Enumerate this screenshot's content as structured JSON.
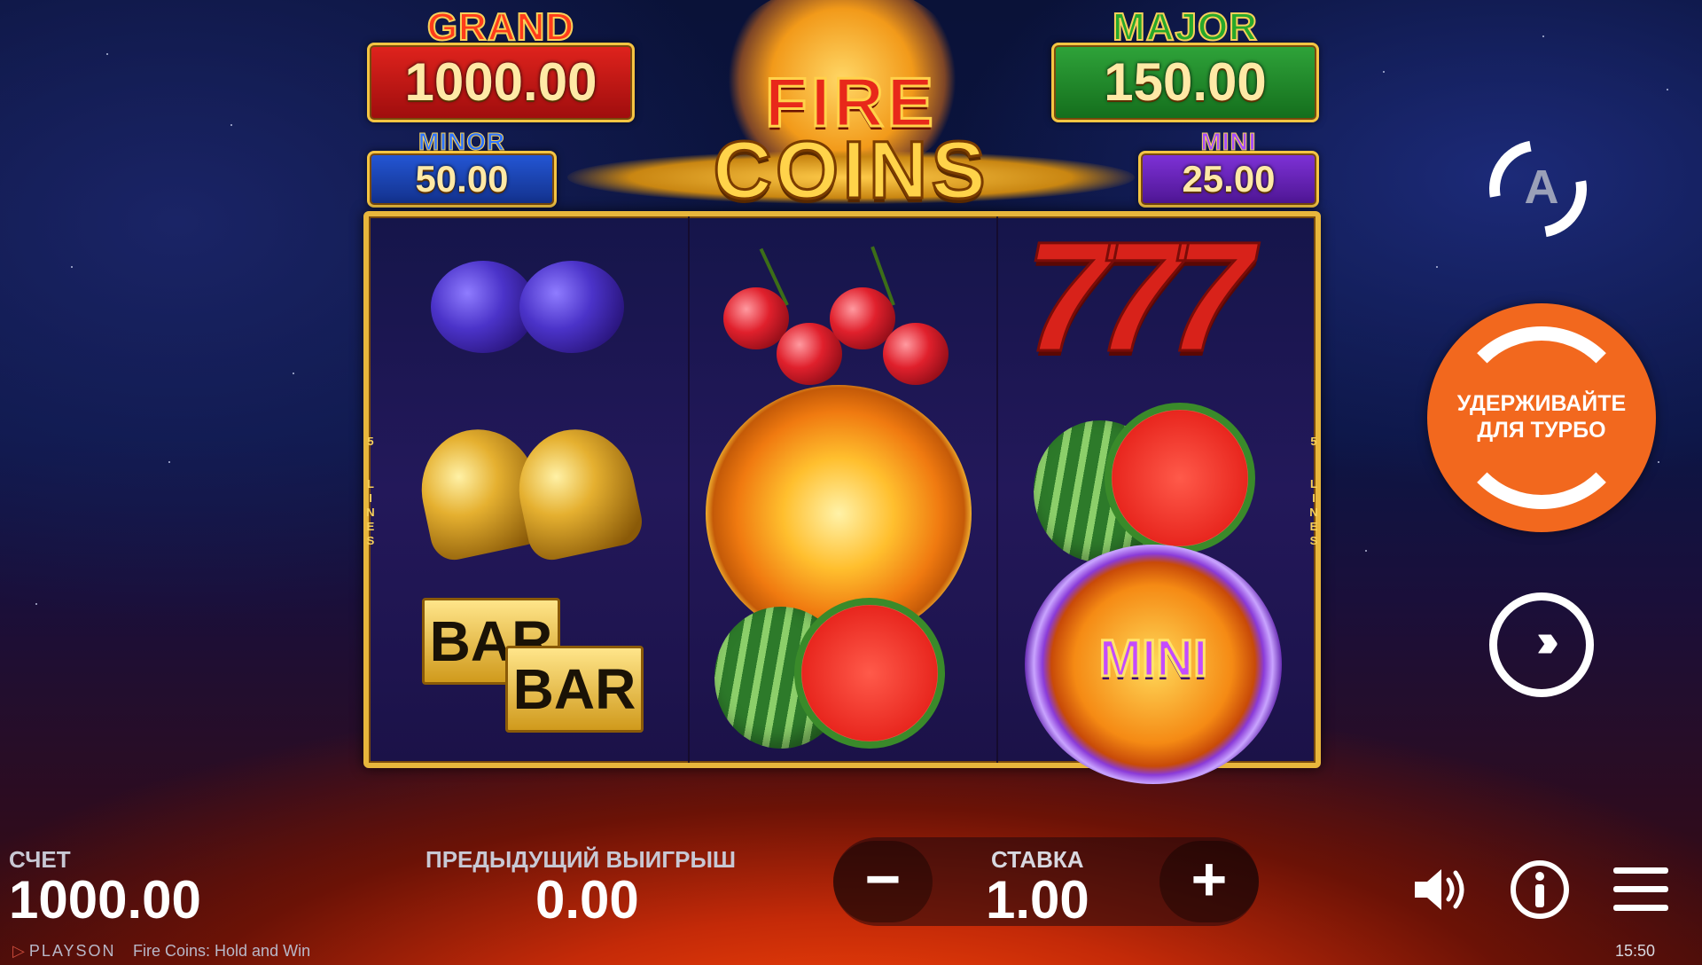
{
  "jackpots": {
    "grand": {
      "title": "GRAND",
      "value": "1000.00"
    },
    "major": {
      "title": "MAJOR",
      "value": "150.00"
    },
    "minor": {
      "title": "MINOR",
      "value": "50.00"
    },
    "mini": {
      "title": "MINI",
      "value": "25.00"
    }
  },
  "logo": {
    "line1": "FIRE",
    "line2": "COINS"
  },
  "reels": {
    "lines_label": "5 LINES",
    "symbols": [
      [
        "plum",
        "bell",
        "bar"
      ],
      [
        "cherry",
        "fire-coin",
        "watermelon"
      ],
      [
        "seven",
        "watermelon",
        "mini-coin"
      ]
    ],
    "bar_text": "BAR",
    "seven_text": "777",
    "mini_coin_text": "MINI"
  },
  "controls": {
    "autoplay_letter": "A",
    "spin_label_line1": "УДЕРЖИВАЙТЕ",
    "spin_label_line2": "ДЛЯ ТУРБО",
    "fast_forward_icon": "fast-forward-icon"
  },
  "bottom": {
    "balance_label": "СЧЕТ",
    "balance_value": "1000.00",
    "last_win_label": "ПРЕДЫДУЩИЙ ВЫИГРЫШ",
    "last_win_value": "0.00",
    "bet_label": "СТАВКА",
    "bet_value": "1.00",
    "minus": "−",
    "plus": "+"
  },
  "footer": {
    "brand": "PLAYSON",
    "game_title": "Fire Coins: Hold and Win",
    "clock": "15:50"
  },
  "colors": {
    "spin_button": "#f2681e",
    "frame_gold": "#e8b63c"
  }
}
